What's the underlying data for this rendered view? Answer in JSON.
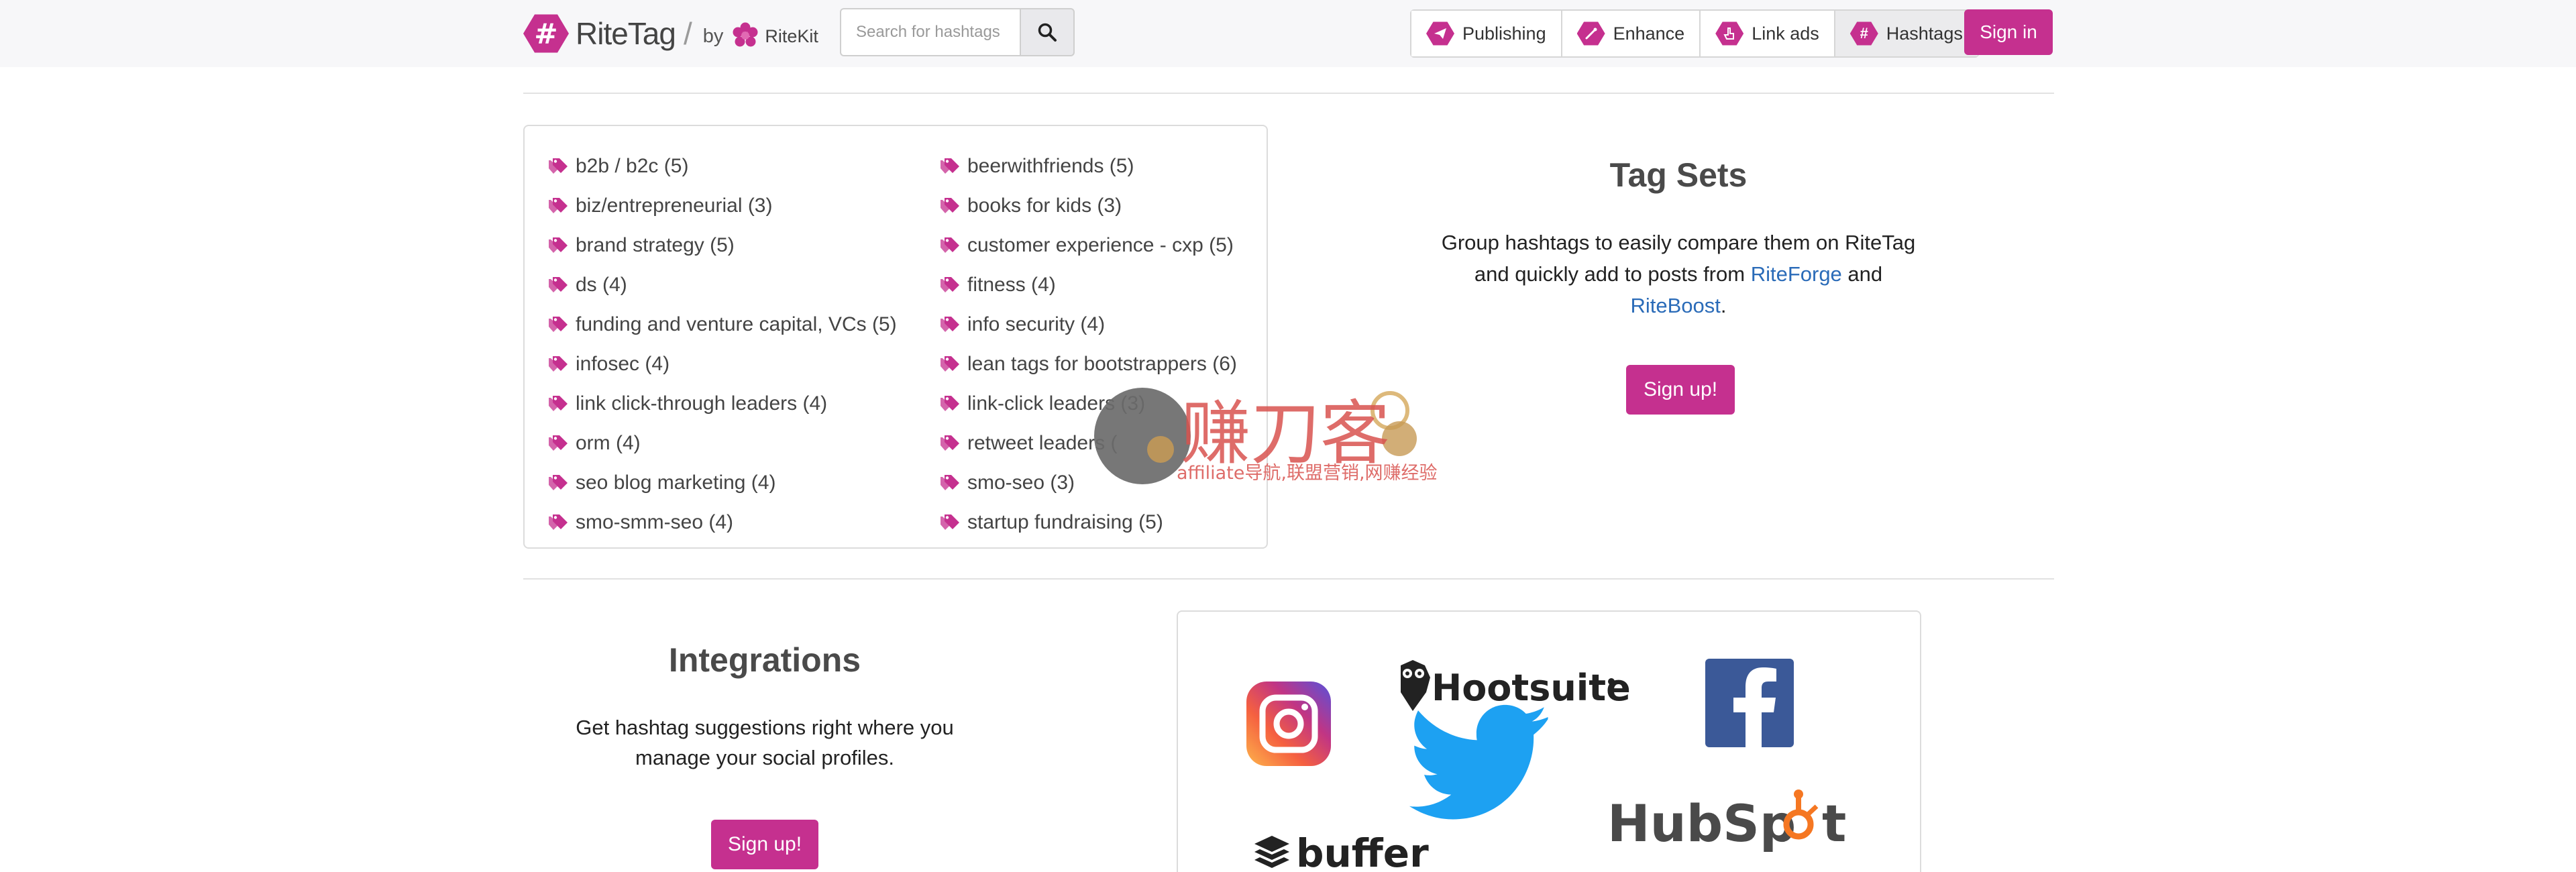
{
  "nav": {
    "brand_name": "RiteTag",
    "brand_by": "by",
    "kit_name": "RiteKit",
    "search_placeholder": "Search for hashtags",
    "buttons": [
      {
        "label": "Publishing",
        "icon": "paper-plane-icon"
      },
      {
        "label": "Enhance",
        "icon": "magic-wand-icon"
      },
      {
        "label": "Link ads",
        "icon": "pointer-hand-icon"
      },
      {
        "label": "Hashtags",
        "icon": "hashtag-icon"
      }
    ],
    "signin_label": "Sign in"
  },
  "tag_sets": {
    "left_column": [
      "b2b / b2c (5)",
      "biz/entrepreneurial (3)",
      "brand strategy (5)",
      "ds (4)",
      "funding and venture capital, VCs (5)",
      "infosec (4)",
      "link click-through leaders (4)",
      "orm (4)",
      "seo blog marketing (4)",
      "smo-smm-seo (4)"
    ],
    "right_column": [
      "beerwithfriends (5)",
      "books for kids (3)",
      "customer experience - cxp (5)",
      "fitness (4)",
      "info security (4)",
      "lean tags for bootstrappers (6)",
      "link-click leaders (3)",
      "retweet leaders (",
      "smo-seo (3)",
      "startup fundraising (5)"
    ],
    "title": "Tag Sets",
    "desc_part1": "Group hashtags to easily compare them on RiteTag and quickly add to posts from ",
    "link_riteforge": "RiteForge",
    "desc_and": " and ",
    "link_riteboost": "RiteBoost",
    "desc_end": ".",
    "cta_label": "Sign up!"
  },
  "integrations": {
    "title": "Integrations",
    "desc": "Get hashtag suggestions right where you manage your social profiles.",
    "cta_label": "Sign up!",
    "logos": {
      "hootsuite": "Hootsuite",
      "buffer": "buffer",
      "hubspot_a": "HubSp",
      "hubspot_b": "t"
    }
  },
  "watermark": {
    "text": "赚刀客",
    "sub": "affiliate导航,联盟营销,网赚经验"
  },
  "colors": {
    "brand": "#c5308f",
    "link": "#2a6bb8",
    "twitter": "#1da1f2",
    "facebook": "#3b5998",
    "hubspot": "#f57722",
    "watermark_red": "#d9534f"
  }
}
